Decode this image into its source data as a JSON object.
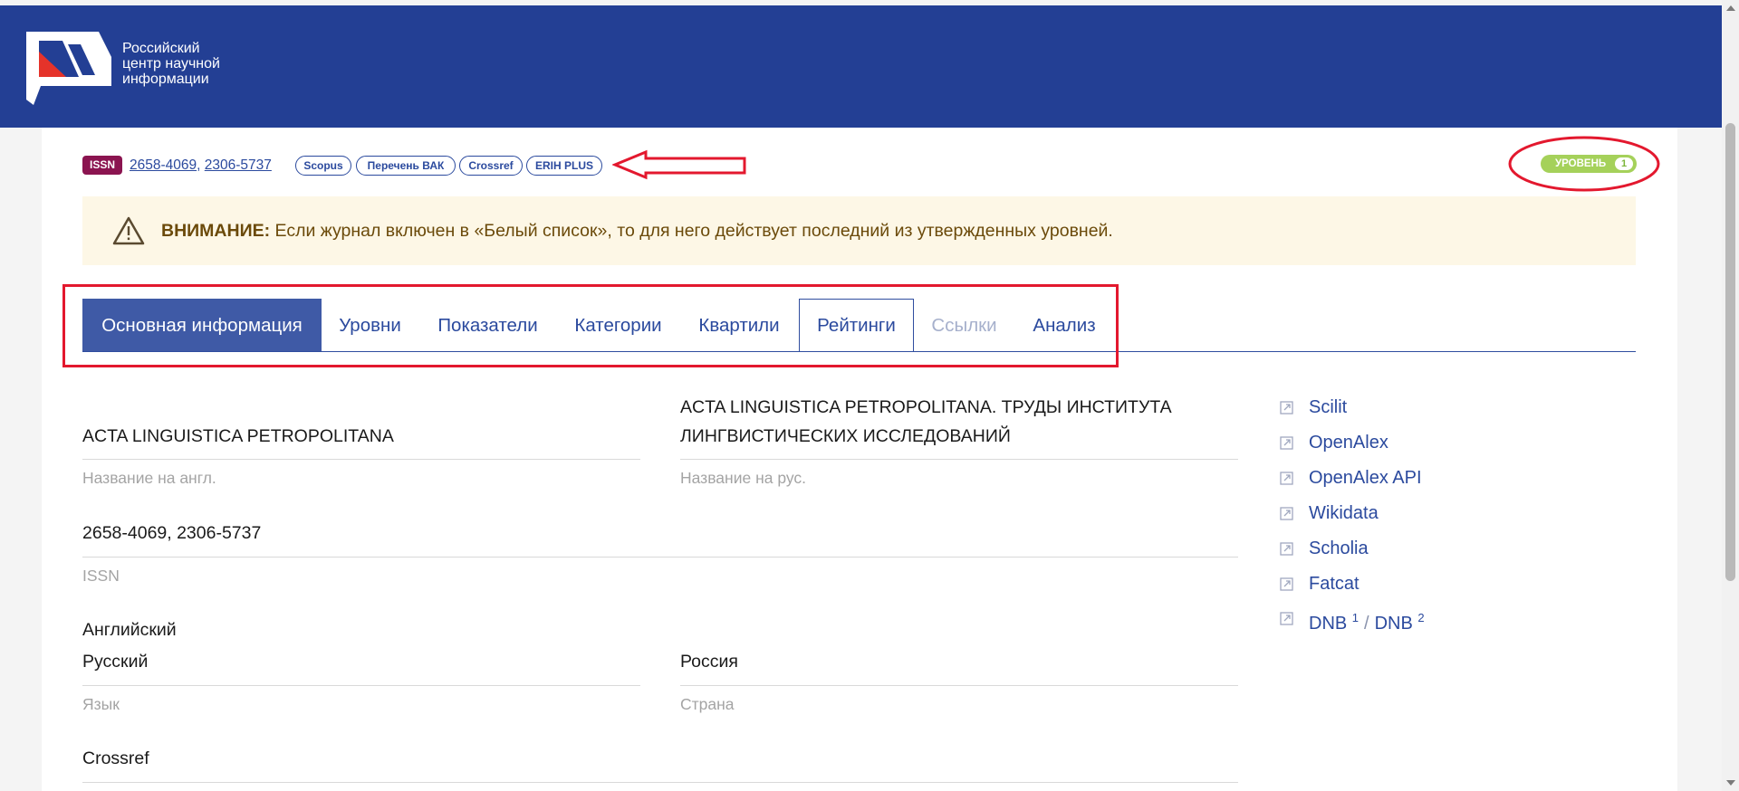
{
  "header": {
    "logo_lines": [
      "Российский",
      "центр научной",
      "информации"
    ]
  },
  "badges": {
    "issn_label": "ISSN",
    "issn_values": [
      "2658-4069",
      "2306-5737"
    ],
    "separator": ",",
    "indexes": [
      "Scopus",
      "Перечень ВАК",
      "Crossref",
      "ERIH PLUS"
    ]
  },
  "level": {
    "label": "УРОВЕНЬ",
    "value": "1"
  },
  "warning": {
    "title": "ВНИМАНИЕ:",
    "text": " Если журнал включен в «Белый список», то для него действует последний из утвержденных уровней."
  },
  "tabs": [
    {
      "label": "Основная информация",
      "state": "active"
    },
    {
      "label": "Уровни",
      "state": "normal"
    },
    {
      "label": "Показатели",
      "state": "normal"
    },
    {
      "label": "Категории",
      "state": "normal"
    },
    {
      "label": "Квартили",
      "state": "normal"
    },
    {
      "label": "Рейтинги",
      "state": "focused"
    },
    {
      "label": "Ссылки",
      "state": "disabled"
    },
    {
      "label": "Анализ",
      "state": "normal"
    }
  ],
  "fields": {
    "title_en": {
      "value": "ACTA LINGUISTICA PETROPOLITANA",
      "label": "Название на англ."
    },
    "title_ru": {
      "value": "ACTA LINGUISTICA PETROPOLITANA. ТРУДЫ ИНСТИТУТА ЛИНГВИСТИЧЕСКИХ ИССЛЕДОВАНИЙ",
      "label": "Название на рус."
    },
    "issn": {
      "value": "2658-4069, 2306-5737",
      "label": "ISSN"
    },
    "language": {
      "values": [
        "Английский",
        "Русский"
      ],
      "label": "Язык"
    },
    "country": {
      "value": "Россия",
      "label": "Страна"
    },
    "doi_source": {
      "value": "Crossref"
    }
  },
  "external_links": {
    "scilit": "Scilit",
    "openalex": "OpenAlex",
    "openalex_api": "OpenAlex API",
    "wikidata": "Wikidata",
    "scholia": "Scholia",
    "fatcat": "Fatcat",
    "dnb": {
      "label": "DNB",
      "sup1": "1",
      "slash": "/",
      "sup2": "2"
    }
  },
  "colors": {
    "header_bg": "#233f94",
    "accent": "#2b4a9e",
    "issn_badge": "#8b1450",
    "level_badge": "#a5d15a",
    "annotation": "#e3182e",
    "warning_bg": "#fdf7e6"
  }
}
